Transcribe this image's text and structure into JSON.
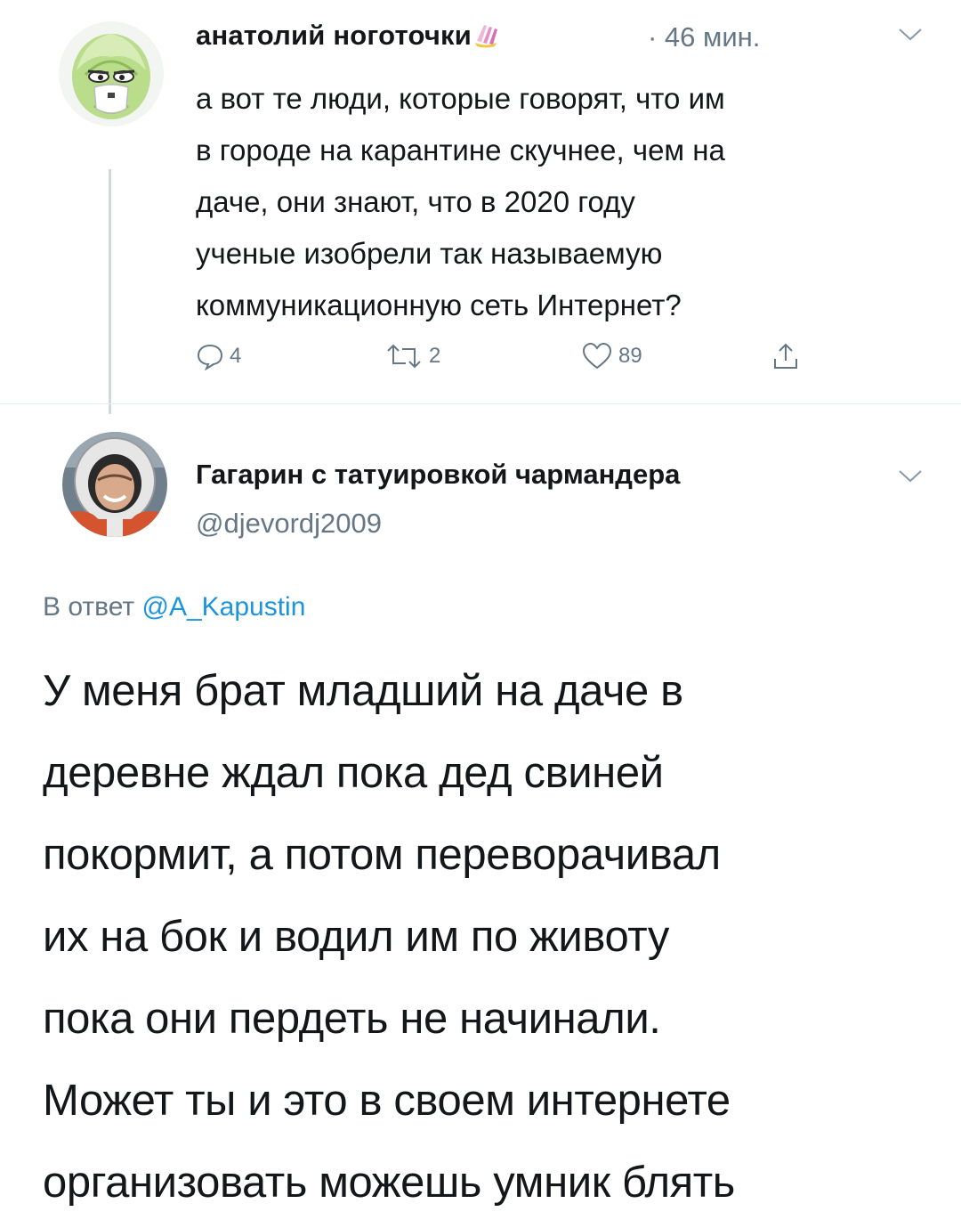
{
  "tweet1": {
    "author_name": "анатолий ноготочки",
    "time": "· 46 мин.",
    "text_lines": [
      "а вот те люди, которые говорят, что им",
      "в городе на карантине скучнее, чем на",
      "даче, они знают, что в 2020 году",
      "ученые изобрели так называемую",
      "коммуникационную сеть Интернет?"
    ],
    "replies": "4",
    "retweets": "2",
    "likes": "89"
  },
  "tweet2": {
    "author_name": "Гагарин с татуировкой чармандера",
    "handle": "@djevordj2009",
    "reply_prefix": "В ответ",
    "reply_mention": "@A_Kapustin",
    "text_lines": [
      "У меня брат младший на даче в",
      "деревне ждал пока дед свиней",
      "покормит, а потом переворачивал",
      "их на бок и водил им по животу",
      "пока они пердеть не начинали.",
      "Может ты и это в своем интернете",
      "организовать можешь умник блять"
    ]
  },
  "icons": {
    "avatar1": "cabbage-with-mask-avatar",
    "avatar2": "cosmonaut-helmet-avatar",
    "emoji": "nail-polish-emoji",
    "reply": "comment-icon",
    "retweet": "retweet-icon",
    "like": "heart-icon",
    "share": "share-icon",
    "menu": "chevron-down-icon"
  },
  "colors": {
    "secondary_text": "#657786",
    "link": "#1b95e0",
    "thread_line": "#cfd9de"
  }
}
